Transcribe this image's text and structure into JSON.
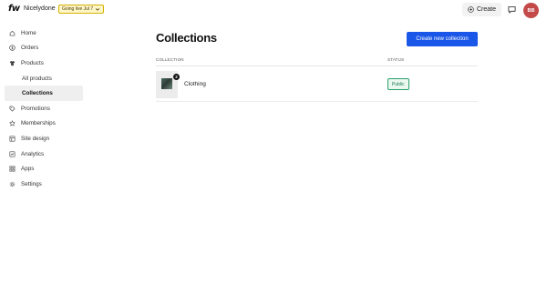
{
  "topbar": {
    "logo": "fw",
    "store_name": "Nicelydone",
    "status_label": "Going live Jul 7",
    "create_label": "Create",
    "avatar_initials": "BB",
    "accent_color": "#1a56e8",
    "avatar_color": "#c44a4a"
  },
  "sidebar": {
    "items": [
      {
        "label": "Home",
        "icon": "home-icon"
      },
      {
        "label": "Orders",
        "icon": "dollar-icon"
      },
      {
        "label": "Products",
        "icon": "shirt-icon"
      },
      {
        "label": "All products",
        "sub": true
      },
      {
        "label": "Collections",
        "sub": true,
        "active": true
      },
      {
        "label": "Promotions",
        "icon": "tag-icon"
      },
      {
        "label": "Memberships",
        "icon": "star-icon"
      },
      {
        "label": "Site design",
        "icon": "layout-icon"
      },
      {
        "label": "Analytics",
        "icon": "chart-icon"
      },
      {
        "label": "Apps",
        "icon": "grid-icon"
      },
      {
        "label": "Settings",
        "icon": "gear-icon"
      }
    ]
  },
  "main": {
    "title": "Collections",
    "new_button_label": "Create new collection",
    "columns": {
      "collection": "COLLECTION",
      "status": "STATUS"
    },
    "rows": [
      {
        "name": "Clothing",
        "count": "2",
        "status": "Public"
      }
    ]
  }
}
